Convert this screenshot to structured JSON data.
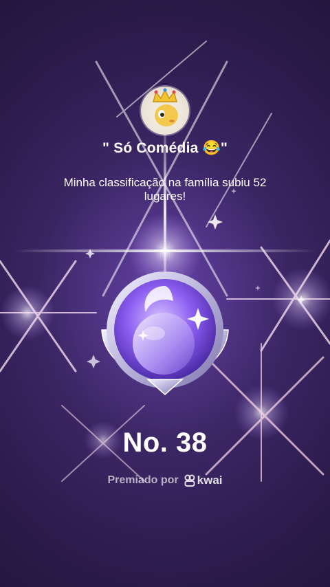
{
  "family": {
    "name": "\" Só Comédia 😂\""
  },
  "message": "Minha classificação na família subiu 52 lugares!",
  "rank": {
    "label": "No. 38"
  },
  "awarded": {
    "prefix": "Premiado por",
    "brand": "kwai"
  },
  "colors": {
    "background": "#2c1b4c",
    "medal_accent": "#8a5cf0",
    "text": "#ffffff"
  },
  "icons": {
    "avatar": "crowned-cartoon-avatar",
    "medal": "moon-star-medal-icon",
    "brand_logo": "kwai-logo-icon"
  }
}
